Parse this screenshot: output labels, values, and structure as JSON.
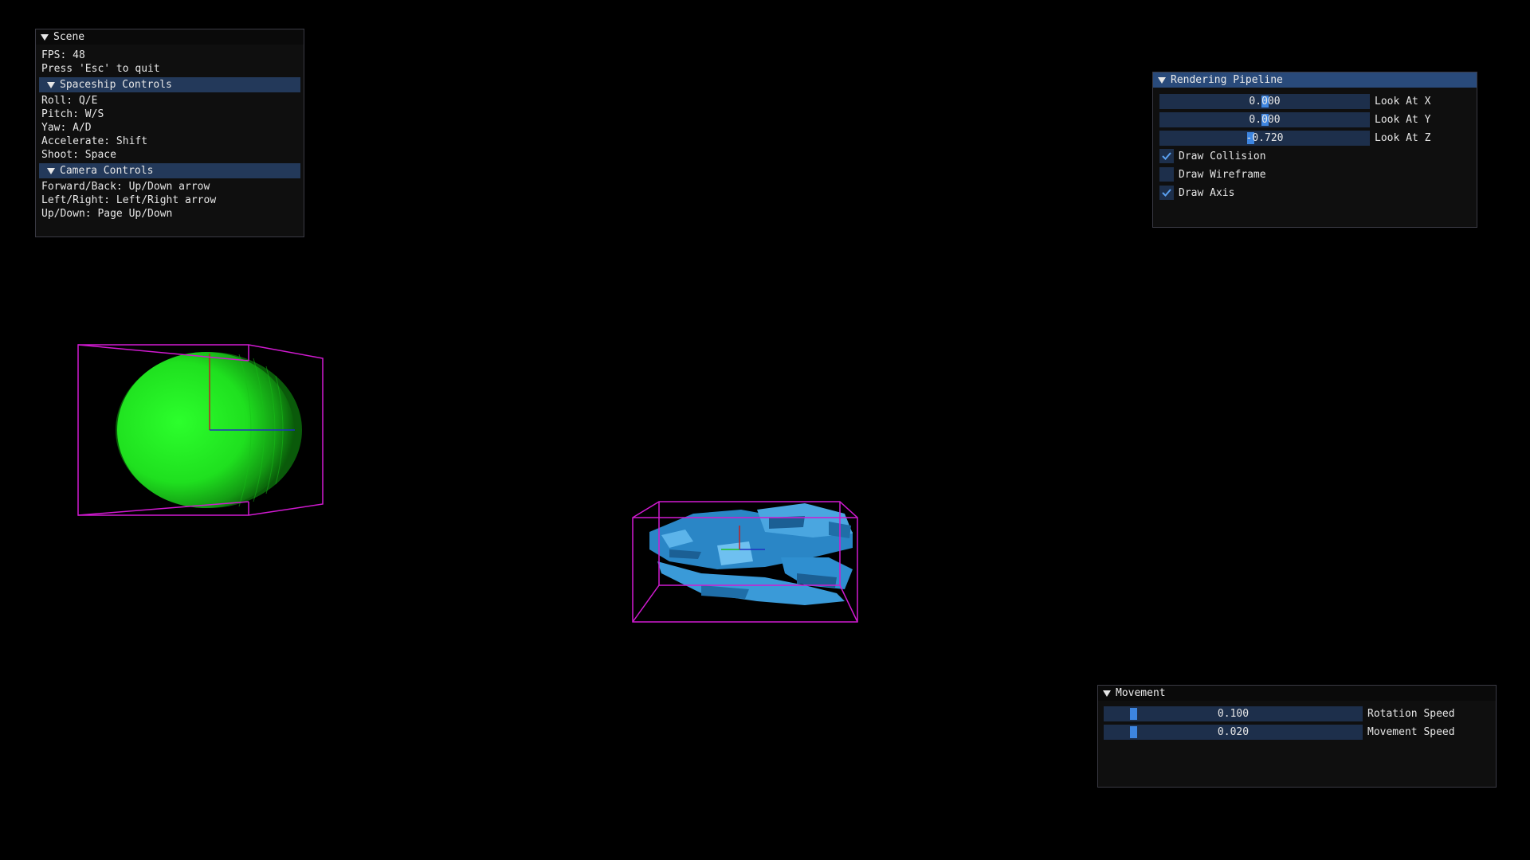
{
  "scene": {
    "title": "Scene",
    "fps": "FPS: 48",
    "quit_hint": "Press 'Esc' to quit",
    "spaceship_header": "Spaceship Controls",
    "spaceship_lines": [
      "Roll: Q/E",
      "Pitch: W/S",
      "Yaw: A/D",
      "Accelerate: Shift",
      "Shoot: Space"
    ],
    "camera_header": "Camera Controls",
    "camera_lines": [
      "Forward/Back: Up/Down arrow",
      "Left/Right: Left/Right arrow",
      "Up/Down: Page Up/Down"
    ]
  },
  "rendering": {
    "title": "Rendering Pipeline",
    "sliders": [
      {
        "label": "Look At X",
        "value": "0.000"
      },
      {
        "label": "Look At Y",
        "value": "0.000"
      },
      {
        "label": "Look At Z",
        "value": "-0.720"
      }
    ],
    "checkboxes": [
      {
        "label": "Draw Collision",
        "checked": true
      },
      {
        "label": "Draw Wireframe",
        "checked": false
      },
      {
        "label": "Draw Axis",
        "checked": true
      }
    ]
  },
  "movement": {
    "title": "Movement",
    "sliders": [
      {
        "label": "Rotation Speed",
        "value": "0.100"
      },
      {
        "label": "Movement Speed",
        "value": "0.020"
      }
    ]
  },
  "colors": {
    "background": "#000000",
    "sphere": "#22ee22",
    "spaceship": "#2f8fd0",
    "collision_box": "#d11ad1",
    "window_title_active": "#294a7a",
    "slider_bg": "#1d2f4b",
    "slider_grab": "#3d85e0"
  },
  "icons": {
    "collapse": "triangle-down-icon",
    "check": "checkmark-icon"
  }
}
